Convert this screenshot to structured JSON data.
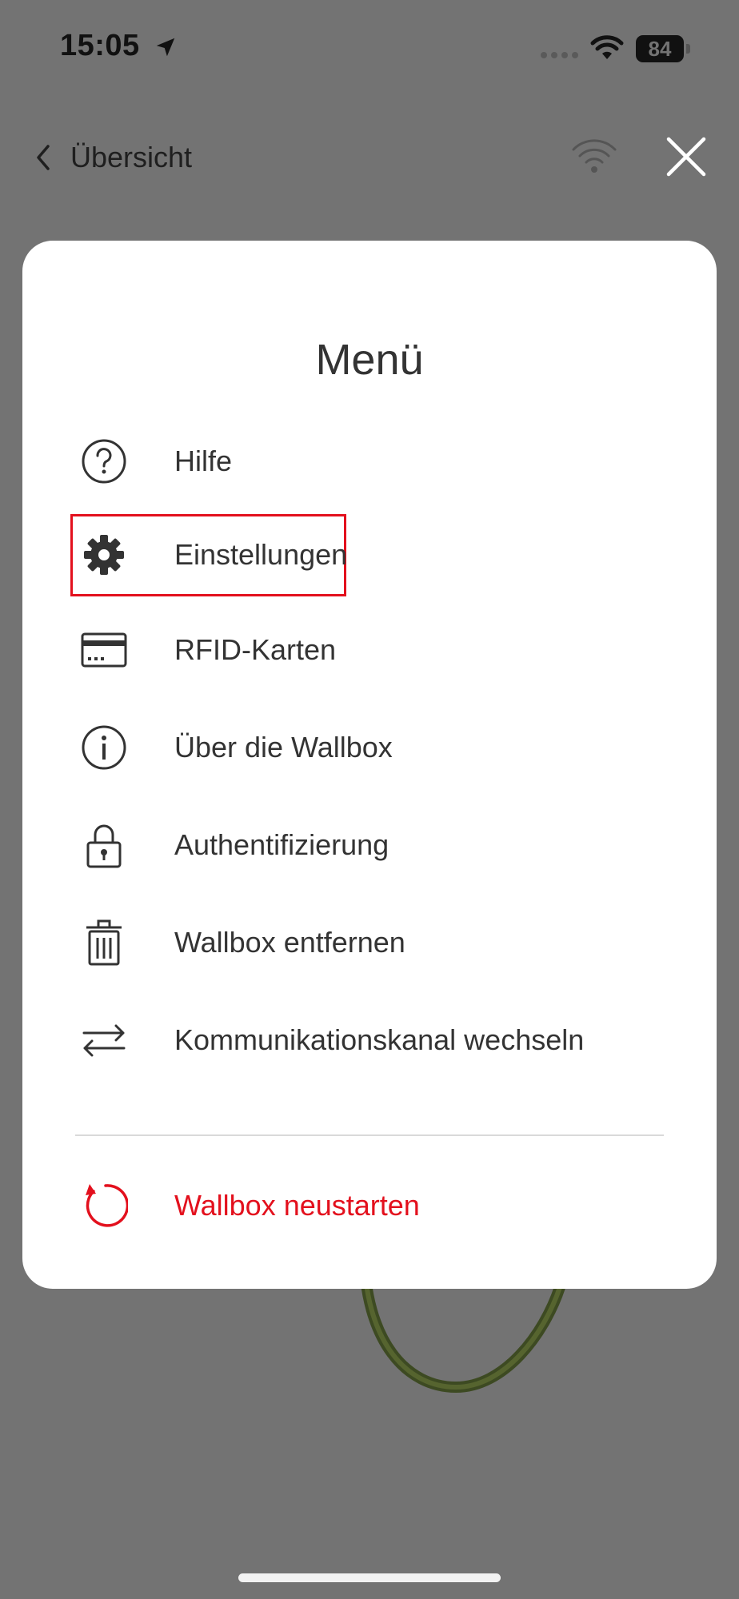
{
  "status_bar": {
    "time": "15:05",
    "battery": "84"
  },
  "nav": {
    "back_label": "Übersicht"
  },
  "menu": {
    "title": "Menü",
    "items": [
      {
        "label": "Hilfe",
        "icon": "help-icon"
      },
      {
        "label": "Einstellungen",
        "icon": "gear-icon"
      },
      {
        "label": "RFID-Karten",
        "icon": "card-icon"
      },
      {
        "label": "Über die Wallbox",
        "icon": "info-icon"
      },
      {
        "label": "Authentifizierung",
        "icon": "lock-icon"
      },
      {
        "label": "Wallbox entfernen",
        "icon": "trash-icon"
      },
      {
        "label": "Kommunikationskanal wechseln",
        "icon": "swap-icon"
      }
    ],
    "restart": {
      "label": "Wallbox neustarten",
      "icon": "restart-icon"
    }
  },
  "colors": {
    "accent_red": "#e3101d",
    "text": "#333333",
    "backdrop": "#737373"
  }
}
